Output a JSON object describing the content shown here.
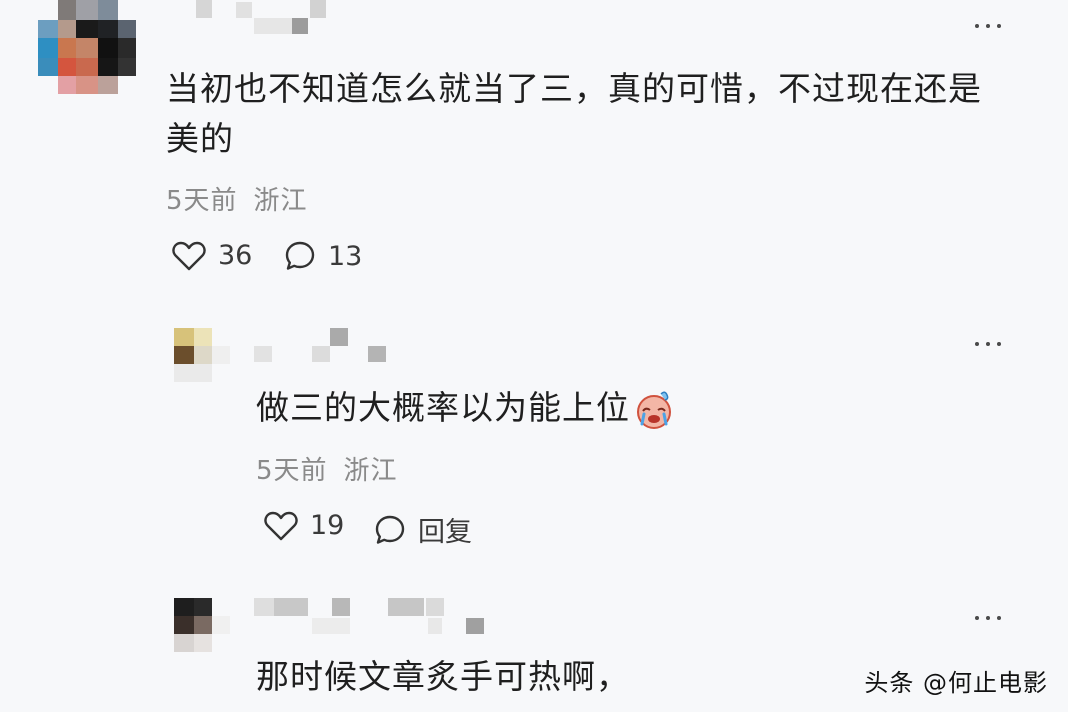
{
  "comments": [
    {
      "text_line1": "当初也不知道怎么就当了三，真的可惜，不过现在还是",
      "text_line2": "美的",
      "time": "5天前",
      "location": "浙江",
      "likes": "36",
      "replies": "13"
    },
    {
      "text": "做三的大概率以为能上位",
      "emoji_icon": "crying-face-emoji-icon",
      "time": "5天前",
      "location": "浙江",
      "likes": "19",
      "reply_label": "回复"
    },
    {
      "text": "那时候文章炙手可热啊，"
    }
  ],
  "watermark": {
    "text": "头条 @何止电影"
  },
  "colors": {
    "background": "#f7f8fa",
    "text": "#1f1f1f",
    "meta": "#8a8a8a"
  }
}
